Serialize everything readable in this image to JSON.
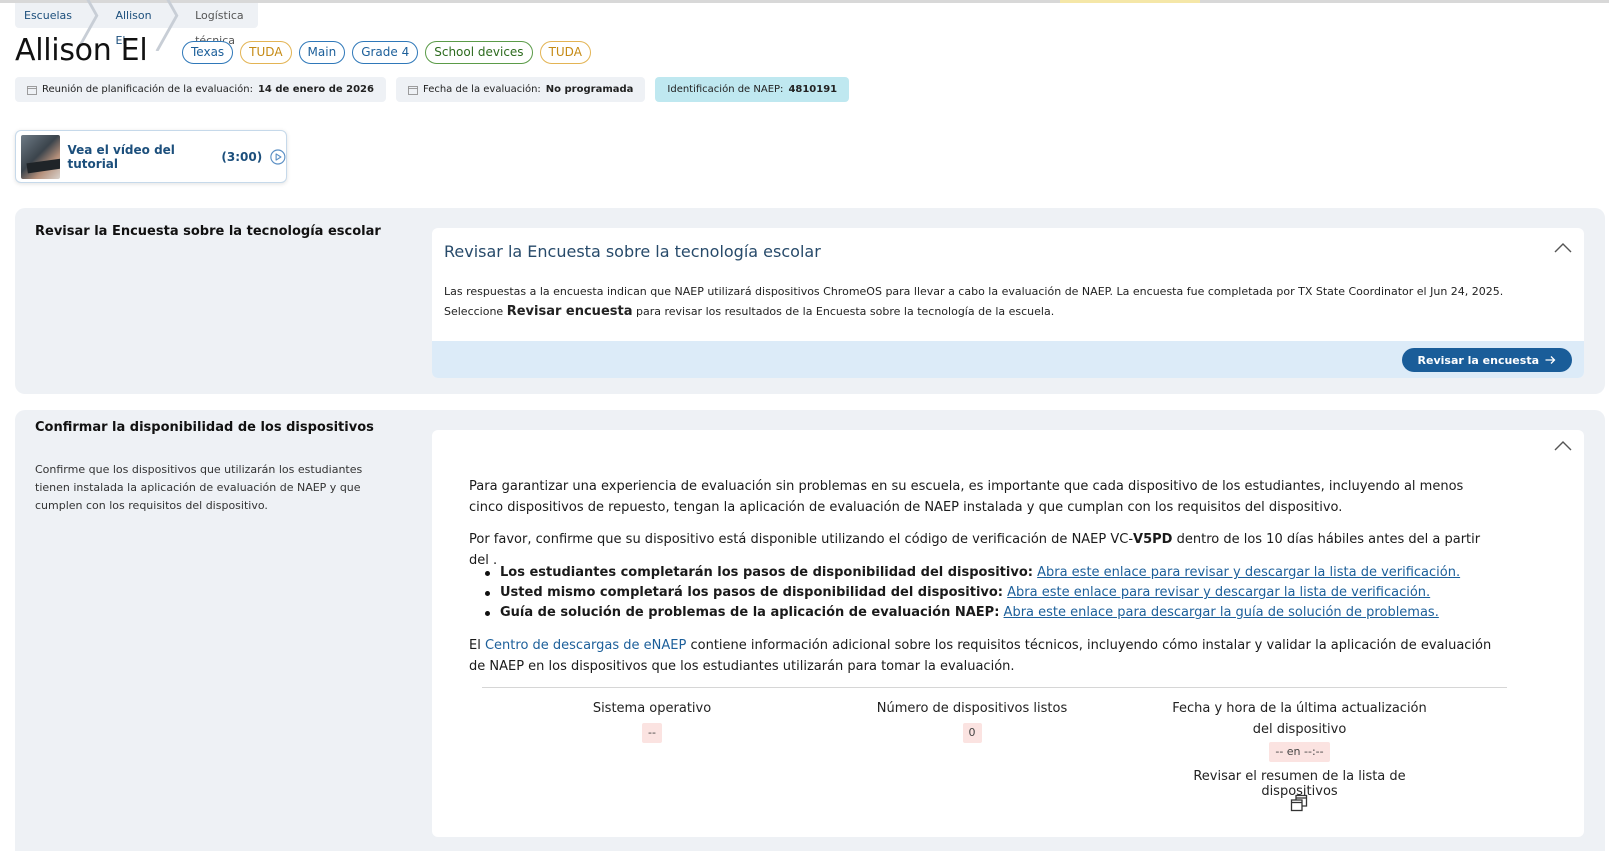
{
  "breadcrumb": [
    "Escuelas",
    "Allison El",
    "Logística técnica"
  ],
  "page_title": "Allison El",
  "tags": [
    {
      "label": "Texas",
      "style": "blue"
    },
    {
      "label": "TUDA",
      "style": "orange"
    },
    {
      "label": "Main",
      "style": "blue"
    },
    {
      "label": "Grade 4",
      "style": "blue"
    },
    {
      "label": "School devices",
      "style": "green"
    },
    {
      "label": "TUDA",
      "style": "orange"
    }
  ],
  "info": {
    "meeting_label": "Reunión de planificación de la evaluación:",
    "meeting_value": "14 de enero de 2026",
    "date_label": "Fecha de la evaluación:",
    "date_value": "No programada",
    "naep_label": "Identificación de NAEP:",
    "naep_value": "4810191"
  },
  "tutorial": {
    "label": "Vea el vídeo del tutorial",
    "duration": "(3:00)"
  },
  "survey": {
    "section_title": "Revisar la Encuesta sobre la tecnología escolar",
    "panel_title": "Revisar la Encuesta sobre la tecnología escolar",
    "text_part1": "Las respuestas a la encuesta indican que NAEP utilizará dispositivos ChromeOS para llevar a cabo la evaluación de NAEP. La encuesta fue completada por TX State Coordinator el Jun 24, 2025. Seleccione",
    "text_bold": "Revisar encuesta",
    "text_part2": "para revisar los resultados de la Encuesta sobre la tecnología de la escuela.",
    "button": "Revisar la encuesta"
  },
  "devices": {
    "section_title": "Confirmar la disponibilidad de los dispositivos",
    "section_desc": "Confirme que los dispositivos que utilizarán los estudiantes tienen instalada la aplicación de evaluación de NAEP y que cumplen con los requisitos del dispositivo.",
    "p1": "Para garantizar una experiencia de evaluación sin problemas en su escuela, es importante que cada dispositivo de los estudiantes, incluyendo al menos cinco dispositivos de repuesto, tengan la aplicación de evaluación de NAEP instalada y que cumplan con los requisitos del dispositivo.",
    "p2_before": "Por favor, confirme que su dispositivo está disponible utilizando el código de verificación de NAEP VC-",
    "p2_code": "V5PD",
    "p2_after": " dentro de los 10 días hábiles antes del a partir del .",
    "bullets": [
      {
        "bold": "Los estudiantes completarán los pasos de disponibilidad del dispositivo:",
        "link": "Abra este enlace para revisar y descargar la lista de verificación."
      },
      {
        "bold": "Usted mismo completará los pasos de disponibilidad del dispositivo:",
        "link": "Abra este enlace para revisar y descargar la lista de verificación."
      },
      {
        "bold": "Guía de solución de problemas de la aplicación de evaluación NAEP:",
        "link": "Abra este enlace para descargar la guía de solución de problemas."
      }
    ],
    "p3_before": "El ",
    "p3_link": "Centro de descargas de eNAEP",
    "p3_after": " contiene información adicional sobre los requisitos técnicos, incluyendo cómo instalar y validar la aplicación de evaluación de NAEP en los dispositivos que los estudiantes utilizarán para tomar la evaluación.",
    "stats": [
      {
        "label": "Sistema operativo",
        "value": "--"
      },
      {
        "label": "Número de dispositivos listos",
        "value": "0"
      },
      {
        "label": "Fecha y hora de la última actualización del dispositivo",
        "value": "-- en --:--"
      }
    ],
    "review_label": "Revisar el resumen de la lista de dispositivos"
  }
}
